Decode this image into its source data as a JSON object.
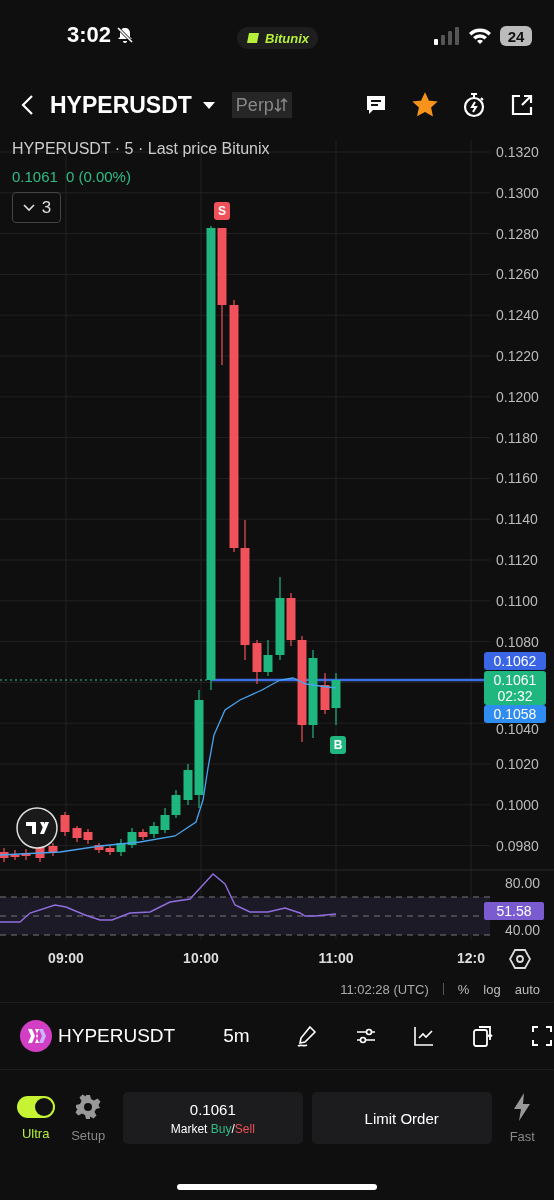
{
  "status_bar": {
    "time": "3:02",
    "app_pill": "Bitunix",
    "battery": "24"
  },
  "header": {
    "symbol": "HYPERUSDT",
    "contract": "Perp",
    "favorite": true
  },
  "legend": {
    "title": "HYPERUSDT · 5 · Last price Bitunix",
    "price": "0.1061",
    "change": "0 (0.00%)",
    "indicator_count": "3",
    "expanded": false
  },
  "price_axis_upper": [
    "0.1320",
    "0.1300",
    "0.1280",
    "0.1260",
    "0.1240",
    "0.1220",
    "0.1200",
    "0.1180",
    "0.1160",
    "0.1140",
    "0.1120",
    "0.1100",
    "0.1080"
  ],
  "price_axis_lower": [
    "0.1040",
    "0.1020",
    "0.1000",
    "0.0980"
  ],
  "price_tags": [
    {
      "kind": "high",
      "text": "0.1062"
    },
    {
      "kind": "last",
      "text": "0.1061",
      "countdown": "02:32"
    },
    {
      "kind": "low",
      "text": "0.1058"
    }
  ],
  "markers": [
    {
      "kind": "sell",
      "text": "S"
    },
    {
      "kind": "buy",
      "text": "B"
    }
  ],
  "rsi": {
    "ticks": [
      "80.00",
      "40.00"
    ],
    "value": "51.58"
  },
  "time_axis": [
    "09:00",
    "10:00",
    "11:00",
    "12:0"
  ],
  "chart_footer": {
    "clock": "11:02:28 (UTC)",
    "options": [
      "%",
      "log",
      "auto"
    ]
  },
  "toolbar": {
    "symbol": "HYPERUSDT",
    "interval": "5m"
  },
  "bottom_bar": {
    "ultra": {
      "label": "Ultra",
      "on": true
    },
    "setup": "Setup",
    "market": {
      "price": "0.1061",
      "prefix": "Market",
      "buy": "Buy",
      "separator": "/",
      "sell": "Sell"
    },
    "limit": "Limit Order",
    "fast": "Fast"
  }
}
